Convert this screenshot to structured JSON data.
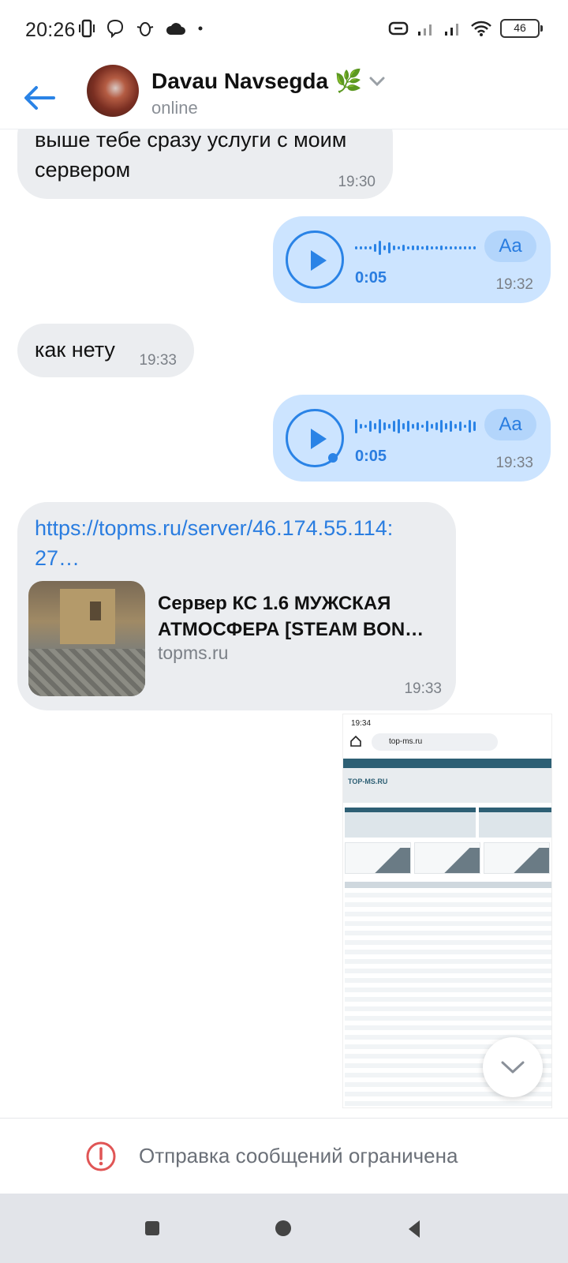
{
  "status_bar": {
    "time": "20:26",
    "battery": "46"
  },
  "header": {
    "title": "Davau Navsegda",
    "title_emoji": "🌿",
    "status": "online"
  },
  "messages": [
    {
      "type": "text",
      "direction": "incoming",
      "text": "выше тебе сразу услуги с моим сервером",
      "time": "19:30"
    },
    {
      "type": "voice",
      "direction": "outgoing",
      "duration": "0:05",
      "transcribe_label": "Aa",
      "time": "19:32"
    },
    {
      "type": "text",
      "direction": "incoming",
      "text": "как нету",
      "time": "19:33"
    },
    {
      "type": "voice",
      "direction": "outgoing",
      "duration": "0:05",
      "transcribe_label": "Aa",
      "time": "19:33"
    },
    {
      "type": "link",
      "direction": "incoming",
      "url_text": "https://topms.ru/server/46.174.55.114:27…",
      "preview_title": "Сервер КС 1.6 МУЖСКАЯ АТМОСФЕРА [STEAM BON…",
      "preview_domain": "topms.ru",
      "time": "19:33"
    },
    {
      "type": "image",
      "direction": "outgoing",
      "embedded_time": "19:34",
      "embedded_url": "top-ms.ru",
      "embedded_logo": "TOP-MS.RU"
    }
  ],
  "composer": {
    "restricted_text": "Отправка сообщений ограничена"
  },
  "colors": {
    "accent": "#2a83e6",
    "incoming_bubble": "#ebedf0",
    "outgoing_bubble": "#cce4ff",
    "error": "#e05555"
  }
}
